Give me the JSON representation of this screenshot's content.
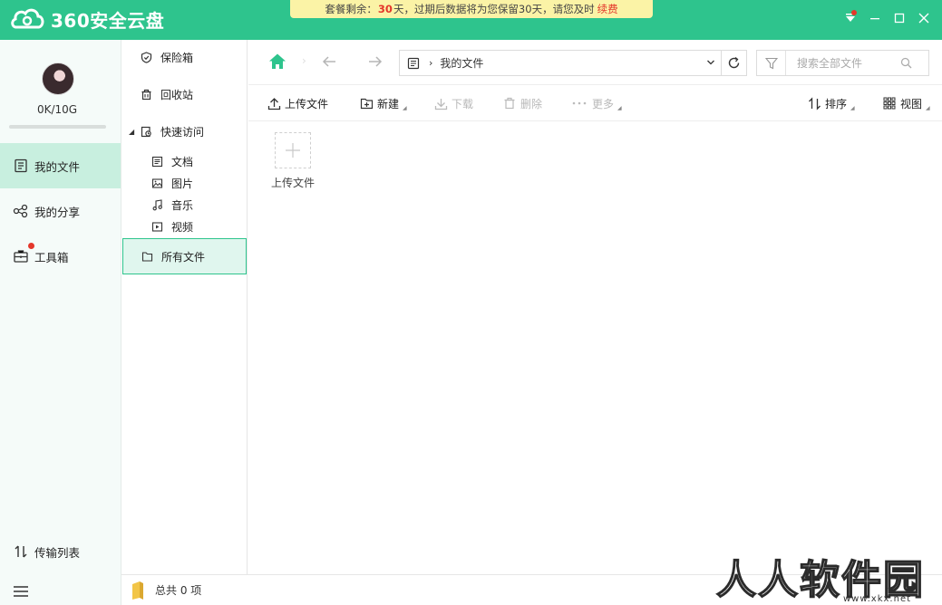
{
  "app": {
    "brand": "360安全云盘",
    "brand_color": "#2ec48d"
  },
  "notice": {
    "prefix": "套餐剩余：",
    "days": "30",
    "days_unit": "天",
    "message": "，过期后数据将为您保留30天，请您及时",
    "renew": "续费"
  },
  "sidebar": {
    "quota": "0K/10G",
    "quota_fraction": 0.0,
    "items": [
      {
        "label": "我的文件",
        "icon": "document-icon",
        "active": true
      },
      {
        "label": "我的分享",
        "icon": "share-icon"
      },
      {
        "label": "工具箱",
        "icon": "toolbox-icon",
        "badge": true
      }
    ],
    "bottom": {
      "transfer": "传输列表",
      "menu_icon": "hamburger-icon"
    }
  },
  "tree": {
    "safe": "保险箱",
    "recycle": "回收站",
    "quick": "快速访问",
    "quick_items": [
      "文档",
      "图片",
      "音乐",
      "视频"
    ],
    "all_files": "所有文件"
  },
  "navbar": {
    "path": "我的文件",
    "search_placeholder": "搜索全部文件"
  },
  "toolbar": {
    "upload": "上传文件",
    "new": "新建",
    "download": "下载",
    "delete": "删除",
    "more": "更多",
    "sort": "排序",
    "view": "视图"
  },
  "content": {
    "upload_tile_label": "上传文件"
  },
  "status": {
    "count": "总共 0 项"
  },
  "watermark": {
    "text": "人人软件园",
    "url": "www.xkx.net"
  }
}
